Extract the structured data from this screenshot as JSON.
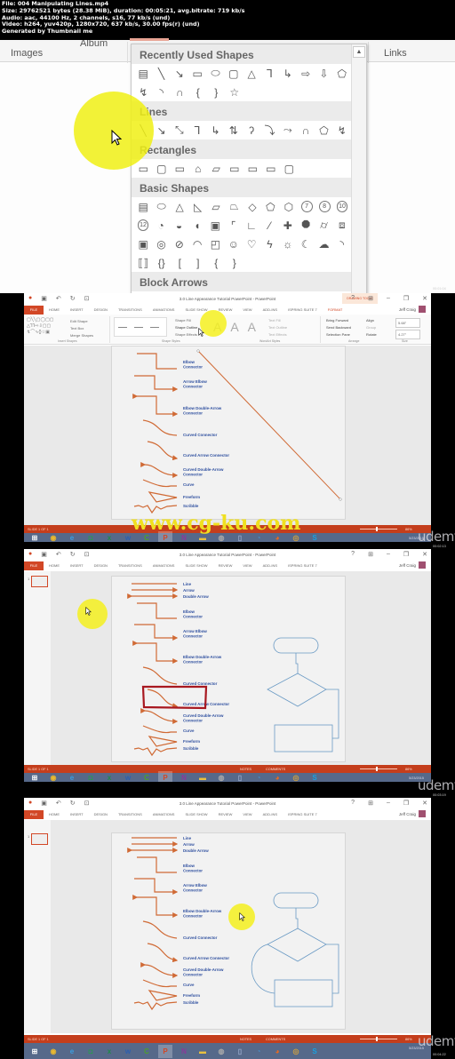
{
  "header": {
    "file": "File: 004 Manipulating Lines.mp4",
    "size": "Size: 29762521 bytes (28.38 MiB), duration: 00:05:21, avg.bitrate: 719 kb/s",
    "audio": "Audio: aac, 44100 Hz, 2 channels, s16, 77 kb/s (und)",
    "video": "Video: h264, yuv420p, 1280x720, 637 kb/s, 30.00 fps(r) (und)",
    "generated": "Generated by Thumbnail me"
  },
  "frame1": {
    "ribbon_groups": [
      "Images",
      "Album",
      "Links"
    ],
    "gallery": {
      "sections": [
        {
          "title": "Recently Used Shapes",
          "rows": [
            [
              "text-box",
              "line",
              "arrow",
              "rectangle",
              "oval",
              "rounded-rectangle",
              "triangle",
              "elbow-connector",
              "elbow-arrow-connector",
              "right-arrow",
              "down-arrow",
              "snip-rectangle"
            ],
            [
              "scribble",
              "arc",
              "curve",
              "left-brace",
              "right-brace",
              "star"
            ]
          ]
        },
        {
          "title": "Lines",
          "rows": [
            [
              "line",
              "arrow",
              "double-arrow",
              "elbow-connector",
              "elbow-arrow-connector",
              "elbow-double-arrow-connector",
              "curved-connector",
              "curved-arrow-connector",
              "curved-double-arrow-connector",
              "curve",
              "freeform",
              "scribble"
            ]
          ]
        },
        {
          "title": "Rectangles",
          "rows": [
            [
              "rectangle",
              "rounded-rectangle",
              "snip-single-corner",
              "snip-same-side",
              "snip-diagonal",
              "snip-round-single",
              "round-single-corner",
              "round-same-side",
              "round-diagonal"
            ]
          ]
        },
        {
          "title": "Basic Shapes",
          "rows": [
            [
              "text-box",
              "oval",
              "triangle",
              "right-triangle",
              "parallelogram",
              "trapezoid",
              "diamond",
              "pentagon",
              "hexagon",
              "heptagon",
              "octagon",
              "decagon"
            ],
            [
              "dodecagon",
              "pie",
              "chord",
              "teardrop",
              "frame",
              "half-frame",
              "l-shape",
              "diagonal-stripe",
              "cross",
              "plaque",
              "can",
              "cube"
            ],
            [
              "bevel",
              "donut",
              "no-symbol",
              "block-arc",
              "folded-corner",
              "smiley",
              "heart",
              "lightning",
              "sun",
              "moon",
              "cloud",
              "arc"
            ],
            [
              "double-bracket",
              "double-brace",
              "left-bracket",
              "right-bracket",
              "left-brace",
              "right-brace"
            ]
          ]
        },
        {
          "title": "Block Arrows",
          "rows": []
        }
      ],
      "polygon_labels": [
        "7",
        "8",
        "10",
        "12"
      ]
    },
    "timestamp": "00:01:04"
  },
  "ppt": {
    "window_title": "3.0 Line Appearance Tutorial PowerPoint - PowerPoint",
    "contextual_tab": "DRAWING TOOLS",
    "tabs": [
      "FILE",
      "HOME",
      "INSERT",
      "DESIGN",
      "TRANSITIONS",
      "ANIMATIONS",
      "SLIDE SHOW",
      "REVIEW",
      "VIEW",
      "ADD-INS",
      "ISPRING SUITE 7",
      "FORMAT"
    ],
    "user": "Jeff Craig",
    "ribbon": {
      "edit_shape": "Edit Shape",
      "text_box": "Text Box",
      "merge_shapes": "Merge Shapes",
      "insert_shapes": "Insert Shapes",
      "shape_styles": "Shape Styles",
      "shape_fill": "Shape Fill",
      "shape_outline": "Shape Outline",
      "shape_effects": "Shape Effects",
      "wordart_styles": "WordArt Styles",
      "text_fill": "Text Fill",
      "text_outline": "Text Outline",
      "text_effects": "Text Effects",
      "bring_forward": "Bring Forward",
      "send_backward": "Send Backward",
      "selection_pane": "Selection Pane",
      "align": "Align",
      "group": "Group",
      "rotate": "Rotate",
      "arrange": "Arrange",
      "height": "5.68\"",
      "width": "4.27\"",
      "size": "Size"
    },
    "slide_labels": {
      "line": "Line",
      "arrow": "Arrow",
      "double_arrow": "Double Arrow",
      "elbow": [
        "Elbow",
        "Connector"
      ],
      "arrow_elbow": [
        "Arrow Elbow",
        "Connector"
      ],
      "elbow_double": [
        "Elbow Double-Arrow",
        "Connector"
      ],
      "curved": "Curved Connector",
      "curved_arrow": "Curved Arrow Connector",
      "curved_double": [
        "Curved Double-Arrow",
        "Connector"
      ],
      "curve": "Curve",
      "freeform": "Freeform",
      "scribble": "Scribble"
    },
    "status": {
      "slide": "SLIDE 1 OF 1",
      "notes": "NOTES",
      "comments": "COMMENTS",
      "zoom": "86%"
    },
    "thumb_number": "1",
    "clock_date": "5/23/2015",
    "taskbar_apps": [
      "windows-start",
      "chrome",
      "internet-explorer",
      "store",
      "excel",
      "word",
      "camtasia",
      "powerpoint",
      "onenote",
      "file-explorer",
      "app-1",
      "notepad",
      "app-2",
      "firefox",
      "app-3",
      "skype"
    ]
  },
  "watermark": "www.cg-ku.com",
  "brand": "udemy",
  "timestamps": [
    "00:01:04",
    "00:02:13",
    "00:03:19",
    "00:04:22"
  ],
  "colors": {
    "accent": "#d24726",
    "status_bar": "#c43e1c",
    "taskbar": "#56698a",
    "line_orange": "#d06a35",
    "label_blue": "#2e4f9f",
    "flowchart_blue": "#6a9ac4",
    "highlight_yellow": "#f5f01e",
    "annotation_red": "#a81820"
  }
}
